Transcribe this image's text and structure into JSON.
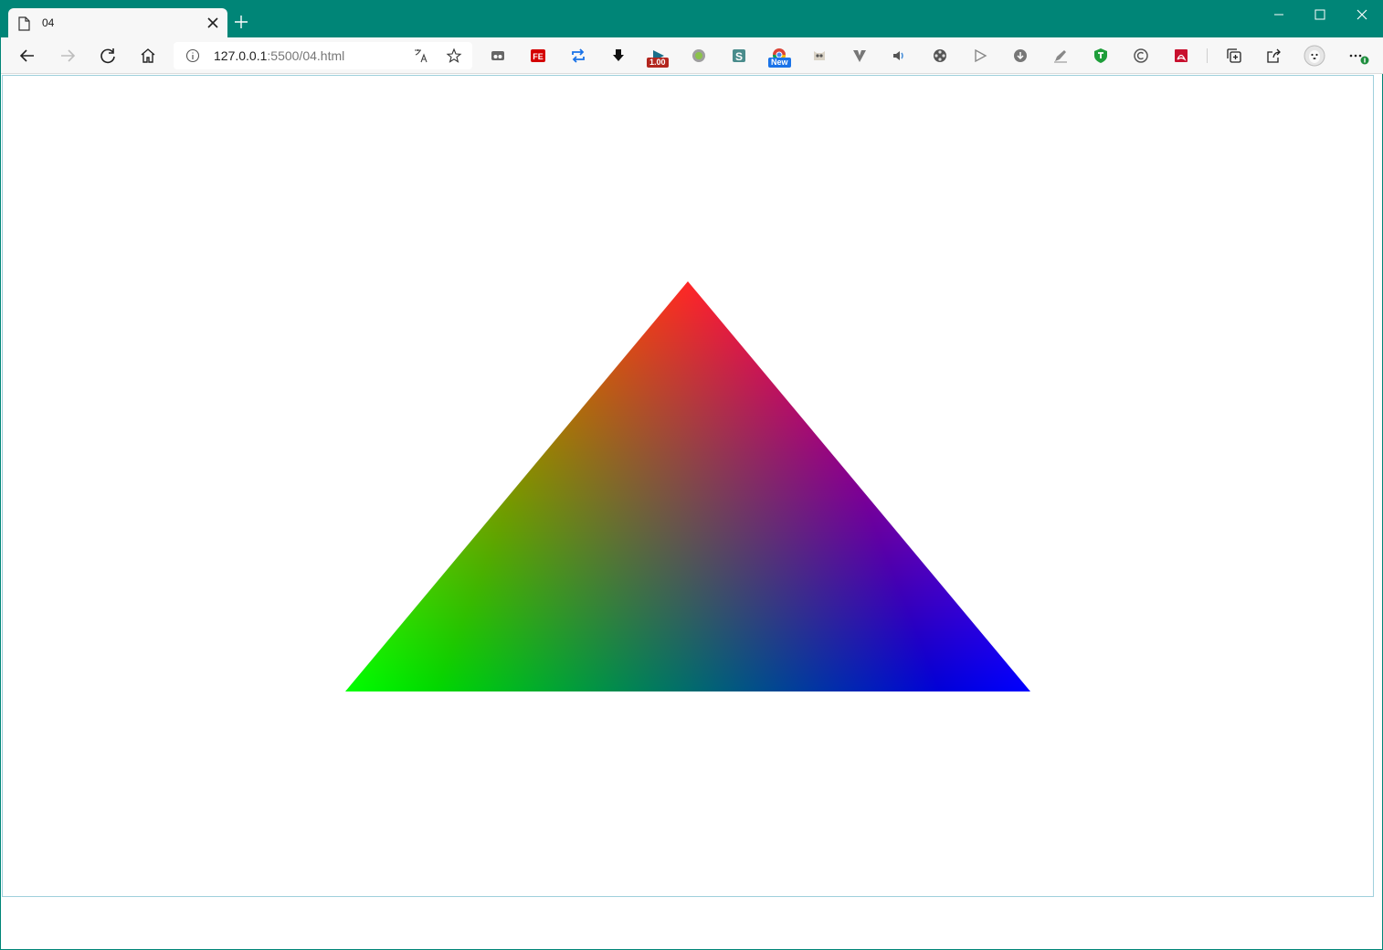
{
  "tab": {
    "title": "04",
    "page_icon": "page-icon",
    "close_icon": "close-icon"
  },
  "new_tab_icon": "plus-icon",
  "window_controls": [
    "minimize-icon",
    "maximize-icon",
    "close-icon"
  ],
  "nav": {
    "back_icon": "arrow-left-icon",
    "forward_icon": "arrow-right-icon",
    "reload_icon": "refresh-icon",
    "home_icon": "home-icon"
  },
  "address": {
    "host": "127.0.0.1",
    "path": ":5500/04.html",
    "info_icon": "info-icon",
    "translate_icon": "translate-icon",
    "favorite_icon": "star-icon"
  },
  "extensions": [
    {
      "name": "puzzle-ext-icon"
    },
    {
      "name": "fe-ext-icon",
      "label": "FE"
    },
    {
      "name": "repeat-ext-icon"
    },
    {
      "name": "download-arrow-ext-icon"
    },
    {
      "name": "speed-ext-icon",
      "badge": "1.00"
    },
    {
      "name": "circle-ext-icon"
    },
    {
      "name": "s-ext-icon",
      "label": "S"
    },
    {
      "name": "chrome-ext-icon",
      "badge": "New"
    },
    {
      "name": "owl-ext-icon"
    },
    {
      "name": "v-ext-icon"
    },
    {
      "name": "speaker-ext-icon"
    },
    {
      "name": "film-ext-icon"
    },
    {
      "name": "play-ext-icon"
    },
    {
      "name": "download-circle-ext-icon"
    },
    {
      "name": "pen-ext-icon"
    },
    {
      "name": "shield-ext-icon"
    },
    {
      "name": "copyright-ext-icon"
    },
    {
      "name": "pdf-ext-icon"
    }
  ],
  "toolbar_right": [
    "collections-icon",
    "share-icon",
    "profile-avatar",
    "more-icon"
  ],
  "colors": {
    "frame": "#008577",
    "vertex_top": "#ff0000",
    "vertex_left": "#00ff00",
    "vertex_right": "#0000ff"
  },
  "scene": {
    "shape": "triangle",
    "vertex_colors": [
      "red",
      "green",
      "blue"
    ]
  }
}
